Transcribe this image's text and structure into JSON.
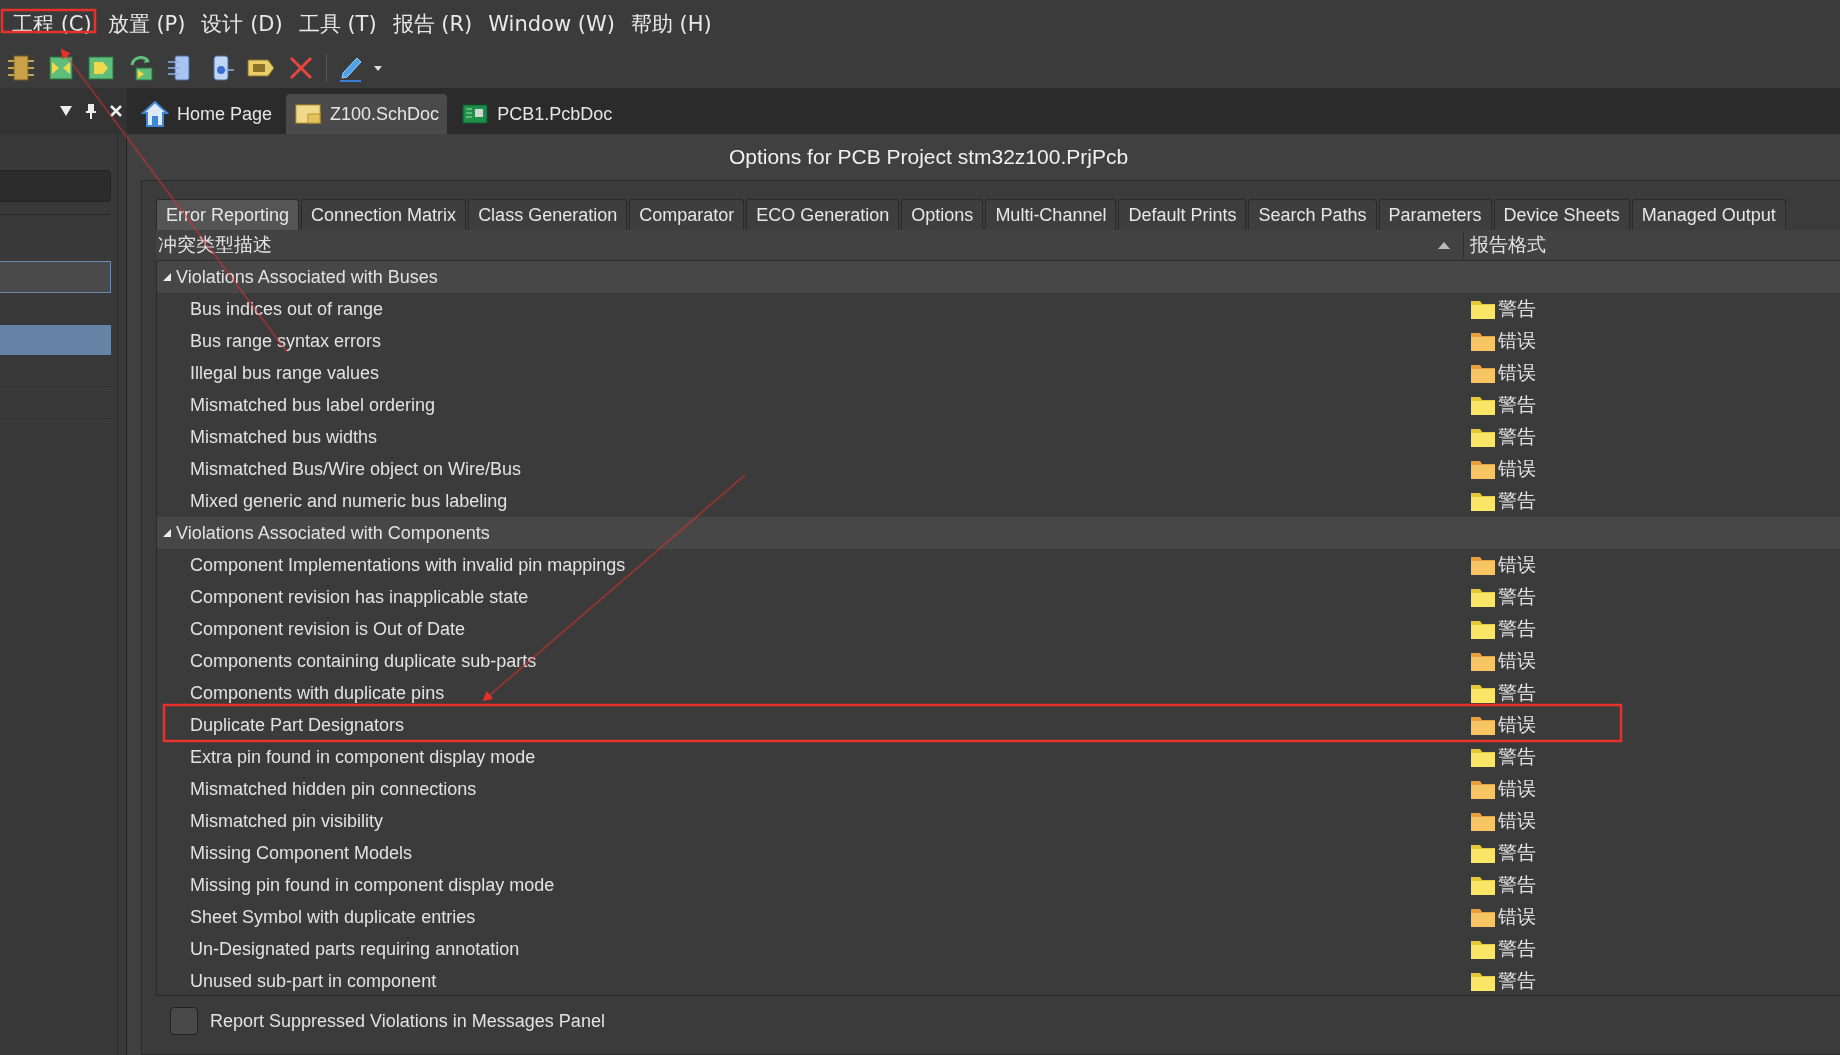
{
  "menu": [
    "工程 (C)",
    "放置 (P)",
    "设计 (D)",
    "工具 (T)",
    "报告 (R)",
    "Window (W)",
    "帮助 (H)"
  ],
  "document_tabs": [
    {
      "label": "Home Page",
      "selected": false,
      "kind": "home"
    },
    {
      "label": "Z100.SchDoc",
      "selected": true,
      "kind": "schematic"
    },
    {
      "label": "PCB1.PcbDoc",
      "selected": false,
      "kind": "pcb"
    }
  ],
  "dialog": {
    "title": "Options for PCB Project stm32z100.PrjPcb",
    "tabs": [
      {
        "label": "Error Reporting",
        "selected": true
      },
      {
        "label": "Connection Matrix",
        "selected": false
      },
      {
        "label": "Class Generation",
        "selected": false
      },
      {
        "label": "Comparator",
        "selected": false
      },
      {
        "label": "ECO Generation",
        "selected": false
      },
      {
        "label": "Options",
        "selected": false
      },
      {
        "label": "Multi-Channel",
        "selected": false
      },
      {
        "label": "Default Prints",
        "selected": false
      },
      {
        "label": "Search Paths",
        "selected": false
      },
      {
        "label": "Parameters",
        "selected": false
      },
      {
        "label": "Device Sheets",
        "selected": false
      },
      {
        "label": "Managed Output",
        "selected": false
      }
    ],
    "columns": [
      "冲突类型描述",
      "报告格式"
    ],
    "groups": [
      {
        "name": "Violations Associated with Buses",
        "expanded": true,
        "rows": [
          {
            "name": "Bus indices out of range",
            "report": "警告",
            "kind": "warning"
          },
          {
            "name": "Bus range syntax errors",
            "report": "错误",
            "kind": "error"
          },
          {
            "name": "Illegal bus range values",
            "report": "错误",
            "kind": "error"
          },
          {
            "name": "Mismatched bus label ordering",
            "report": "警告",
            "kind": "warning"
          },
          {
            "name": "Mismatched bus widths",
            "report": "警告",
            "kind": "warning"
          },
          {
            "name": "Mismatched Bus/Wire object on Wire/Bus",
            "report": "错误",
            "kind": "error"
          },
          {
            "name": "Mixed generic and numeric bus labeling",
            "report": "警告",
            "kind": "warning"
          }
        ]
      },
      {
        "name": "Violations Associated with Components",
        "expanded": true,
        "rows": [
          {
            "name": "Component Implementations with invalid pin mappings",
            "report": "错误",
            "kind": "error"
          },
          {
            "name": "Component revision has inapplicable state",
            "report": "警告",
            "kind": "warning"
          },
          {
            "name": "Component revision is Out of Date",
            "report": "警告",
            "kind": "warning"
          },
          {
            "name": "Components containing duplicate sub-parts",
            "report": "错误",
            "kind": "error"
          },
          {
            "name": "Components with duplicate pins",
            "report": "警告",
            "kind": "warning"
          },
          {
            "name": "Duplicate Part Designators",
            "report": "错误",
            "kind": "error"
          },
          {
            "name": "Extra pin found in component display mode",
            "report": "警告",
            "kind": "warning"
          },
          {
            "name": "Mismatched hidden pin connections",
            "report": "错误",
            "kind": "error"
          },
          {
            "name": "Mismatched pin visibility",
            "report": "错误",
            "kind": "error"
          },
          {
            "name": "Missing Component Models",
            "report": "警告",
            "kind": "warning"
          },
          {
            "name": "Missing pin found in component display mode",
            "report": "警告",
            "kind": "warning"
          },
          {
            "name": "Sheet Symbol with duplicate entries",
            "report": "错误",
            "kind": "error"
          },
          {
            "name": "Un-Designated parts requiring annotation",
            "report": "警告",
            "kind": "warning"
          },
          {
            "name": "Unused sub-part in component",
            "report": "警告",
            "kind": "warning"
          }
        ]
      }
    ],
    "footer": {
      "label": "Report Suppressed Violations in Messages Panel",
      "checked": false
    }
  }
}
